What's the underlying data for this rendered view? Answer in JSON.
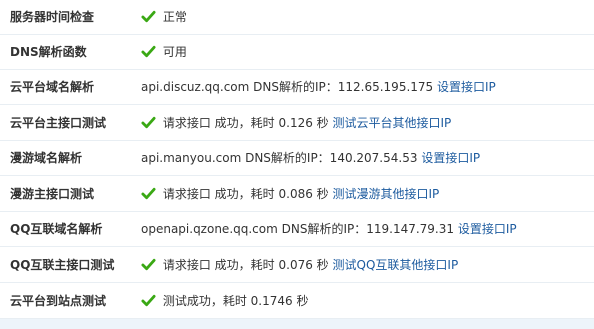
{
  "rows": [
    {
      "label": "服务器时间检查",
      "status": "正常"
    },
    {
      "label": "DNS解析函数",
      "status": "可用"
    },
    {
      "label": "云平台域名解析",
      "text": "api.discuz.qq.com DNS解析的IP：112.65.195.175",
      "link": "设置接口IP"
    },
    {
      "label": "云平台主接口测试",
      "part1": "请求接口",
      "part2": "成功，耗时",
      "time": "0.126 秒",
      "link": "测试云平台其他接口IP"
    },
    {
      "label": "漫游域名解析",
      "text": "api.manyou.com DNS解析的IP：140.207.54.53",
      "link": "设置接口IP"
    },
    {
      "label": "漫游主接口测试",
      "part1": "请求接口",
      "part2": "成功，耗时",
      "time": "0.086 秒",
      "link": "测试漫游其他接口IP"
    },
    {
      "label": "QQ互联域名解析",
      "text": "openapi.qzone.qq.com DNS解析的IP：119.147.79.31",
      "link": "设置接口IP"
    },
    {
      "label": "QQ互联主接口测试",
      "part1": "请求接口",
      "part2": "成功，耗时",
      "time": "0.076 秒",
      "link": "测试QQ互联其他接口IP"
    },
    {
      "label": "云平台到站点测试",
      "part1": "测试成功，耗时",
      "time": "0.1746 秒"
    }
  ],
  "colors": {
    "check_green": "#3aa814",
    "link_blue": "#1d5b9f",
    "row_border": "#e8eef3"
  },
  "icons": {
    "check": "check-icon"
  }
}
